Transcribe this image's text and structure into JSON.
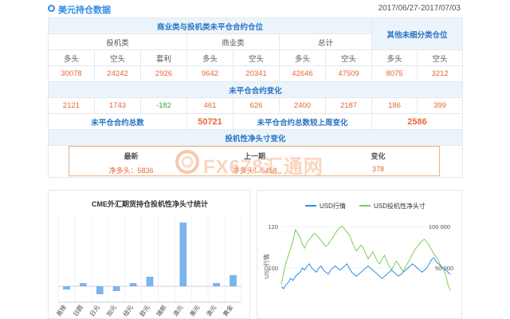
{
  "header": {
    "title": "美元持仓数据",
    "date_range": "2017/06/27-2017/07/03"
  },
  "table": {
    "group_commercial_spec": "商业类与投机类未平仓合约仓位",
    "group_other": "其他未细分类仓位",
    "sub_spec": "投机类",
    "sub_comm": "商业类",
    "sub_total": "总计",
    "col_long": "多头",
    "col_short": "空头",
    "col_spread": "套利",
    "positions": [
      "30078",
      "24242",
      "2926",
      "9642",
      "20341",
      "42646",
      "47509",
      "8075",
      "3212"
    ],
    "change_title": "未平仓合约变化",
    "changes": [
      "2121",
      "1743",
      "-182",
      "461",
      "626",
      "2400",
      "2187",
      "186",
      "399"
    ],
    "oi_total_label": "未平仓合约总数",
    "oi_total_value": "50721",
    "oi_change_label": "未平仓合约总数较上周变化",
    "oi_change_value": "2586",
    "net_title": "投机性净头寸变化"
  },
  "net_box": {
    "latest_label": "最新",
    "prev_label": "上一期",
    "change_label": "变化",
    "latest_value": "净多头：5836",
    "prev_value": "净多头：5458",
    "change_value": "378"
  },
  "watermark": {
    "text": "FX678汇通网"
  },
  "chart_data": [
    {
      "type": "bar",
      "title": "CME外汇期货持仓投机性净头寸统计",
      "categories": [
        "英镑",
        "日圆",
        "日元",
        "加元",
        "纽元",
        "欧元",
        "瑞郎",
        "澳元",
        "美元",
        "澳元",
        "黄金"
      ],
      "values": [
        -2,
        2,
        -5,
        -3,
        2,
        6,
        0,
        40,
        0,
        2,
        7
      ],
      "grid": true,
      "colors": {
        "bar": "#7cb4ec"
      }
    },
    {
      "type": "line",
      "title": "",
      "ylabel": "USD行情",
      "y_left_ticks": [
        "120",
        "100"
      ],
      "y_right_ticks": [
        "100 000",
        "50 000"
      ],
      "series": [
        {
          "name": "USD行情",
          "color": "#2f8ee0",
          "values": [
            91,
            90,
            92,
            93,
            95,
            94,
            96,
            97,
            98,
            100,
            99,
            101,
            102,
            100,
            99,
            98,
            100,
            101,
            99,
            98,
            97,
            99,
            100,
            101,
            100,
            99,
            100,
            101,
            102,
            100,
            98,
            97,
            96,
            97,
            98,
            99,
            100,
            101,
            100,
            99,
            98,
            97,
            96,
            95,
            96,
            97,
            98,
            99,
            98,
            97,
            96,
            97,
            98,
            99,
            100,
            101,
            102,
            101,
            100,
            99,
            98,
            99,
            100,
            102,
            104,
            105,
            103,
            102,
            101,
            100,
            99,
            98,
            97
          ]
        },
        {
          "name": "USD投机性净头寸",
          "color": "#7ccd5a",
          "values": [
            20,
            35,
            50,
            60,
            70,
            80,
            95,
            90,
            85,
            75,
            70,
            78,
            82,
            86,
            90,
            88,
            84,
            80,
            76,
            72,
            75,
            80,
            85,
            90,
            95,
            98,
            100,
            96,
            92,
            88,
            80,
            72,
            66,
            70,
            74,
            70,
            62,
            55,
            60,
            65,
            58,
            52,
            48,
            55,
            60,
            52,
            45,
            40,
            46,
            52,
            48,
            42,
            38,
            44,
            50,
            56,
            62,
            68,
            72,
            76,
            80,
            82,
            78,
            74,
            68,
            62,
            58,
            52,
            46,
            40,
            34,
            20,
            12
          ]
        }
      ]
    }
  ]
}
